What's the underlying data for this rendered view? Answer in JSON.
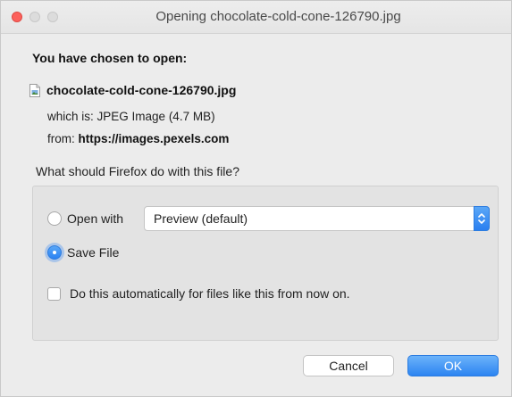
{
  "window": {
    "title": "Opening chocolate-cold-cone-126790.jpg"
  },
  "dialog": {
    "heading": "You have chosen to open:",
    "file_name": "chocolate-cold-cone-126790.jpg",
    "file_icon": "image-file-icon",
    "which_label": "which is:",
    "which_value": "JPEG Image (4.7 MB)",
    "from_label": "from:",
    "from_value": "https://images.pexels.com",
    "question": "What should Firefox do with this file?"
  },
  "options": {
    "open_with_label": "Open with",
    "open_with_selected": false,
    "application": "Preview (default)",
    "save_file_label": "Save File",
    "save_file_selected": true,
    "auto_label": "Do this automatically for files like this from now on.",
    "auto_checked": false
  },
  "buttons": {
    "cancel": "Cancel",
    "ok": "OK"
  },
  "colors": {
    "accent": "#2c84f1",
    "close_button": "#fc605b",
    "panel_bg": "#e3e3e3",
    "window_bg": "#ececec"
  }
}
